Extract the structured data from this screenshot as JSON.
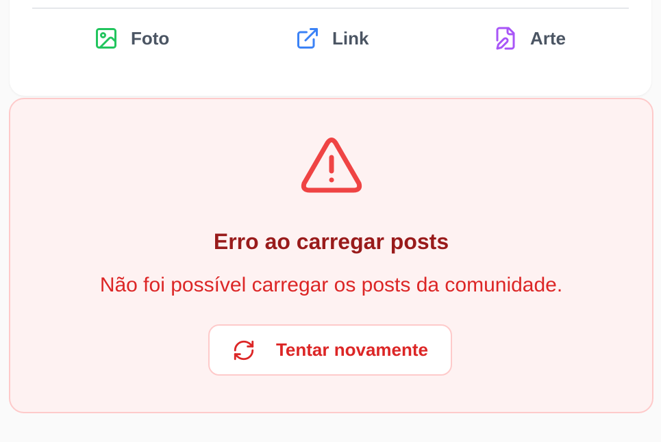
{
  "composer": {
    "actions": [
      {
        "label": "Foto",
        "icon": "image-icon",
        "color": "#22c55e"
      },
      {
        "label": "Link",
        "icon": "external-link-icon",
        "color": "#3b82f6"
      },
      {
        "label": "Arte",
        "icon": "file-pen-icon",
        "color": "#a855f7"
      }
    ]
  },
  "error": {
    "icon": "alert-triangle-icon",
    "title": "Erro ao carregar posts",
    "message": "Não foi possível carregar os posts da comunidade.",
    "retry_label": "Tentar novamente",
    "retry_icon": "refresh-icon",
    "colors": {
      "accent": "#dc2626",
      "title": "#991b1b",
      "background": "#fef2f2",
      "border": "#fecaca"
    }
  }
}
